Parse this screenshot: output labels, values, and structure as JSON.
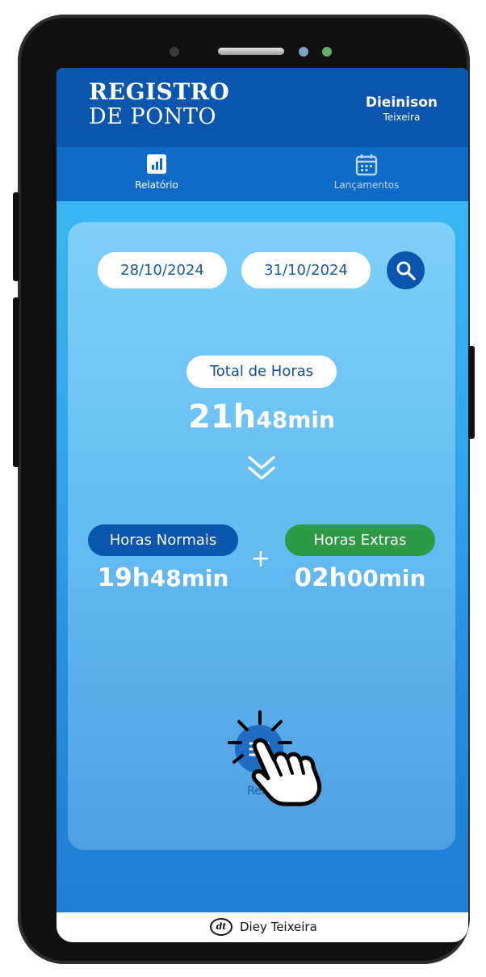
{
  "header": {
    "title_line1": "REGISTRO",
    "title_line2": "DE PONTO",
    "user_first_name": "Dieinison",
    "user_last_name": "Teixeira"
  },
  "tabs": [
    {
      "label": "Relatório",
      "icon": "bar-chart-icon",
      "active": true
    },
    {
      "label": "Lançamentos",
      "icon": "calendar-icon",
      "active": false
    }
  ],
  "filters": {
    "start_date": "28/10/2024",
    "end_date": "31/10/2024",
    "search_icon": "search-icon"
  },
  "summary": {
    "total_label": "Total de Horas",
    "total_hours": "21h",
    "total_minutes": "48min",
    "normal_label": "Horas Normais",
    "normal_hours": "19h",
    "normal_minutes": "48min",
    "extra_label": "Horas Extras",
    "extra_hours": "02h",
    "extra_minutes": "00min",
    "plus_sign": "+"
  },
  "report_button": {
    "label": "Relat",
    "icon": "report-list-icon"
  },
  "footer": {
    "logo_text": "dt",
    "brand": "Diey Teixeira"
  },
  "colors": {
    "header_blue": "#0a55ad",
    "tab_blue": "#0d6bc7",
    "normal_pill": "#0a55ad",
    "extra_pill": "#2e9a45"
  }
}
